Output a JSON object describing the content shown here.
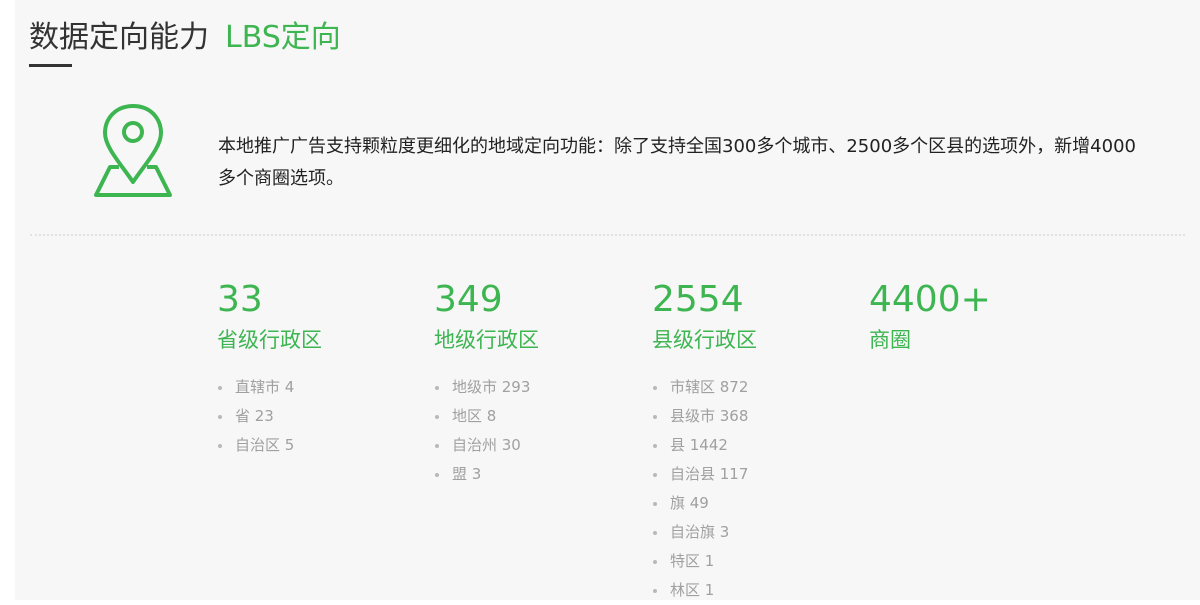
{
  "heading": {
    "main": "数据定向能力",
    "sub": "LBS定向"
  },
  "icon": "map-pin-icon",
  "colors": {
    "accent": "#3db551",
    "text": "#222222",
    "muted": "#a0a0a0",
    "panel": "#f7f7f7"
  },
  "intro": "本地推广广告支持颗粒度更细化的地域定向功能：除了支持全国300多个城市、2500多个区县的选项外，新增4000多个商圈选项。",
  "stats": [
    {
      "number": "33",
      "label": "省级行政区",
      "items": [
        "直辖市 4",
        "省 23",
        "自治区 5"
      ]
    },
    {
      "number": "349",
      "label": "地级行政区",
      "items": [
        "地级市 293",
        "地区 8",
        "自治州 30",
        "盟 3"
      ]
    },
    {
      "number": "2554",
      "label": "县级行政区",
      "items": [
        "市辖区 872",
        "县级市 368",
        "县 1442",
        "自治县 117",
        "旗 49",
        "自治旗 3",
        "特区 1",
        "林区 1"
      ]
    },
    {
      "number": "4400+",
      "label": "商圈",
      "items": []
    }
  ]
}
